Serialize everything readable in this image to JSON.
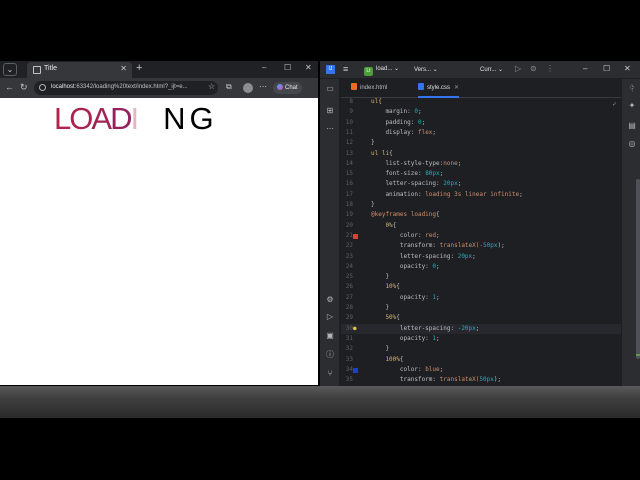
{
  "browser": {
    "tab_title": "Title",
    "url_host": "localhost",
    "url_rest": ":63342/loading%20text/index.html?_ijt=e...",
    "chat_label": "Chat"
  },
  "page": {
    "letters": [
      {
        "char": "L",
        "color": "#b0264a"
      },
      {
        "char": "O",
        "color": "#a9244e"
      },
      {
        "char": "A",
        "color": "#a02354"
      },
      {
        "char": "D",
        "color": "#95205c"
      },
      {
        "char": "I",
        "color": "#e5b5c3"
      },
      {
        "char": "N",
        "color": "#000000"
      },
      {
        "char": "G",
        "color": "#000000"
      }
    ]
  },
  "ide": {
    "logo": "IJ",
    "project_badge": "Lt",
    "project": "load...",
    "vcs": "Vers...",
    "run_config": "Curr...",
    "tabs": [
      {
        "label": "index.html",
        "active": false,
        "icon_color": "#e56d2b"
      },
      {
        "label": "style.css",
        "active": true,
        "icon_color": "#3574f0"
      }
    ],
    "lines": [
      {
        "n": "8",
        "tokens": [
          [
            "ul{",
            "sel"
          ]
        ]
      },
      {
        "n": "9",
        "tokens": [
          [
            "    margin: ",
            "prop"
          ],
          [
            "0",
            "num"
          ],
          [
            ";",
            "br"
          ]
        ]
      },
      {
        "n": "10",
        "tokens": [
          [
            "    padding: ",
            "prop"
          ],
          [
            "0",
            "num"
          ],
          [
            ";",
            "br"
          ]
        ]
      },
      {
        "n": "11",
        "tokens": [
          [
            "    display: ",
            "prop"
          ],
          [
            "flex",
            "kw"
          ],
          [
            ";",
            "br"
          ]
        ]
      },
      {
        "n": "12",
        "tokens": [
          [
            "}",
            "br"
          ]
        ]
      },
      {
        "n": "13",
        "tokens": [
          [
            "ul li",
            "sel"
          ],
          [
            "{",
            "br"
          ]
        ]
      },
      {
        "n": "14",
        "tokens": [
          [
            "    list-style-type:",
            "prop"
          ],
          [
            "none",
            "kw"
          ],
          [
            ";",
            "br"
          ]
        ]
      },
      {
        "n": "15",
        "tokens": [
          [
            "    font-size: ",
            "prop"
          ],
          [
            "80px",
            "num"
          ],
          [
            ";",
            "br"
          ]
        ]
      },
      {
        "n": "16",
        "tokens": [
          [
            "    letter-spacing: ",
            "prop"
          ],
          [
            "20px",
            "num"
          ],
          [
            ";",
            "br"
          ]
        ]
      },
      {
        "n": "17",
        "tokens": [
          [
            "    animation: ",
            "prop"
          ],
          [
            "loading 3s linear infinite",
            "kw"
          ],
          [
            ";",
            "br"
          ]
        ]
      },
      {
        "n": "18",
        "tokens": [
          [
            "}",
            "br"
          ]
        ]
      },
      {
        "n": "19",
        "tokens": [
          [
            "@keyframes loading",
            "kw"
          ],
          [
            "{",
            "br"
          ]
        ]
      },
      {
        "n": "20",
        "tokens": [
          [
            "    0%",
            "pct"
          ],
          [
            "{",
            "br"
          ]
        ]
      },
      {
        "n": "21",
        "gutter": "#e53935",
        "tokens": [
          [
            "        color: ",
            "prop"
          ],
          [
            "red",
            "kw"
          ],
          [
            ";",
            "br"
          ]
        ]
      },
      {
        "n": "22",
        "tokens": [
          [
            "        transform: ",
            "prop"
          ],
          [
            "translateX(",
            "kw"
          ],
          [
            "-50px",
            "num"
          ],
          [
            ");",
            "br"
          ]
        ]
      },
      {
        "n": "23",
        "tokens": [
          [
            "        letter-spacing: ",
            "prop"
          ],
          [
            "20px",
            "num"
          ],
          [
            ";",
            "br"
          ]
        ]
      },
      {
        "n": "24",
        "tokens": [
          [
            "        opacity: ",
            "prop"
          ],
          [
            "0",
            "num"
          ],
          [
            ";",
            "br"
          ]
        ]
      },
      {
        "n": "25",
        "tokens": [
          [
            "    }",
            "br"
          ]
        ]
      },
      {
        "n": "26",
        "tokens": [
          [
            "    10%",
            "pct"
          ],
          [
            "{",
            "br"
          ]
        ]
      },
      {
        "n": "27",
        "tokens": [
          [
            "        opacity: ",
            "prop"
          ],
          [
            "1",
            "num"
          ],
          [
            ";",
            "br"
          ]
        ]
      },
      {
        "n": "28",
        "tokens": [
          [
            "    }",
            "br"
          ]
        ]
      },
      {
        "n": "29",
        "tokens": [
          [
            "    50%",
            "pct"
          ],
          [
            "{",
            "br"
          ]
        ]
      },
      {
        "n": "30",
        "bulb": true,
        "caret": true,
        "tokens": [
          [
            "        letter-spacing: ",
            "prop"
          ],
          [
            "-20px",
            "num"
          ],
          [
            ";",
            "br"
          ]
        ]
      },
      {
        "n": "31",
        "tokens": [
          [
            "        opacity: ",
            "prop"
          ],
          [
            "1",
            "num"
          ],
          [
            ";",
            "br"
          ]
        ]
      },
      {
        "n": "32",
        "tokens": [
          [
            "    }",
            "br"
          ]
        ]
      },
      {
        "n": "33",
        "tokens": [
          [
            "    100%",
            "pct"
          ],
          [
            "{",
            "br"
          ]
        ]
      },
      {
        "n": "34",
        "gutter": "#1e3bd6",
        "tokens": [
          [
            "        color: ",
            "prop"
          ],
          [
            "blue",
            "kw"
          ],
          [
            ";",
            "br"
          ]
        ]
      },
      {
        "n": "35",
        "tokens": [
          [
            "        transform: ",
            "prop"
          ],
          [
            "translateX(",
            "kw"
          ],
          [
            "50px",
            "num"
          ],
          [
            ");",
            "br"
          ]
        ]
      }
    ]
  }
}
